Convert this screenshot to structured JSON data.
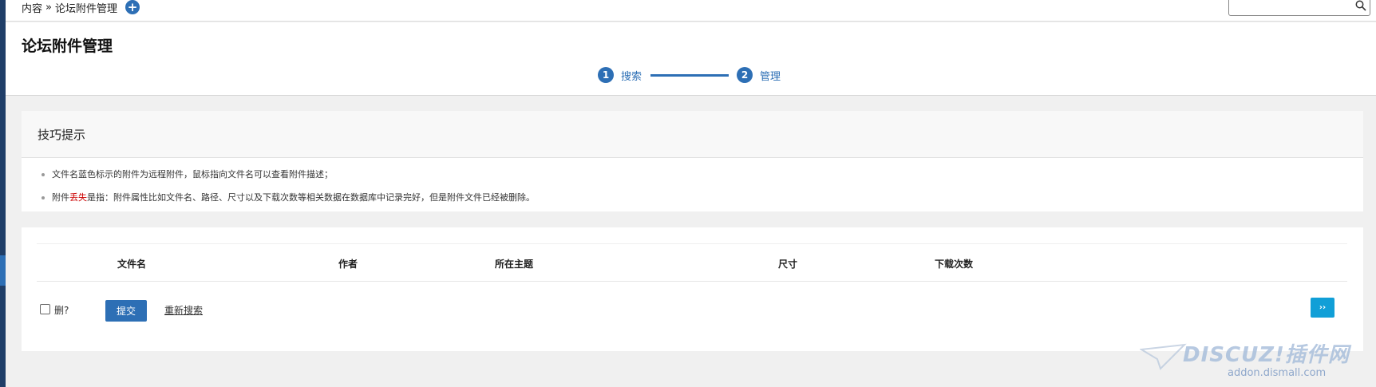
{
  "breadcrumb": {
    "root": "内容",
    "separator": "»",
    "current": "论坛附件管理",
    "add_icon": "+"
  },
  "search": {
    "placeholder": "",
    "icon": "search-icon"
  },
  "page": {
    "title": "论坛附件管理"
  },
  "steps": [
    {
      "num": "1",
      "label": "搜索"
    },
    {
      "num": "2",
      "label": "管理"
    }
  ],
  "tips": {
    "title": "技巧提示",
    "items": [
      {
        "text": "文件名蓝色标示的附件为远程附件，鼠标指向文件名可以查看附件描述；"
      },
      {
        "prefix": "附件",
        "highlight": "丢失",
        "suffix": "是指：附件属性比如文件名、路径、尺寸以及下载次数等相关数据在数据库中记录完好，但是附件文件已经被删除。"
      }
    ]
  },
  "table": {
    "columns": [
      "文件名",
      "作者",
      "所在主题",
      "尺寸",
      "下载次数"
    ]
  },
  "actions": {
    "delete_label": "删?",
    "submit_label": "提交",
    "reset_label": "重新搜索",
    "next_label": "››"
  },
  "watermark": {
    "logo": "DISCUZ!插件网",
    "sub": "addon.dismall.com"
  },
  "colors": {
    "accent": "#2d6fb5",
    "next_button": "#119fd7",
    "sidebar": "#1f3e68",
    "warning": "#cc0000"
  }
}
